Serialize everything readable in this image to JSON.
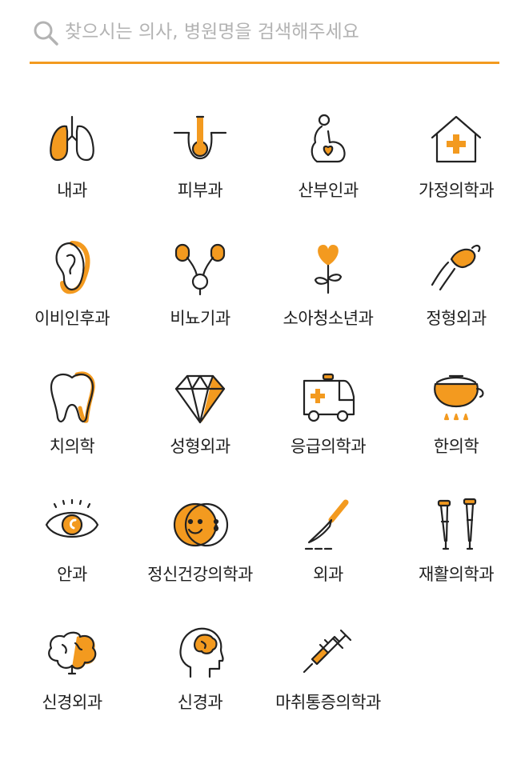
{
  "search": {
    "placeholder": "찾으시는 의사, 병원명을 검색해주세요",
    "value": ""
  },
  "categories": [
    {
      "label": "내과",
      "icon": "lungs-icon"
    },
    {
      "label": "피부과",
      "icon": "skin-follicle-icon"
    },
    {
      "label": "산부인과",
      "icon": "pregnant-woman-icon"
    },
    {
      "label": "가정의학과",
      "icon": "house-medical-icon"
    },
    {
      "label": "이비인후과",
      "icon": "ear-icon"
    },
    {
      "label": "비뇨기과",
      "icon": "kidneys-bladder-icon"
    },
    {
      "label": "소아청소년과",
      "icon": "heart-flower-icon"
    },
    {
      "label": "정형외과",
      "icon": "joint-bone-icon"
    },
    {
      "label": "치의학",
      "icon": "tooth-icon"
    },
    {
      "label": "성형외과",
      "icon": "diamond-icon"
    },
    {
      "label": "응급의학과",
      "icon": "ambulance-icon"
    },
    {
      "label": "한의학",
      "icon": "herbal-pot-icon"
    },
    {
      "label": "안과",
      "icon": "eye-icon"
    },
    {
      "label": "정신건강의학과",
      "icon": "smiling-face-icon"
    },
    {
      "label": "외과",
      "icon": "scalpel-icon"
    },
    {
      "label": "재활의학과",
      "icon": "crutches-icon"
    },
    {
      "label": "신경외과",
      "icon": "brain-icon"
    },
    {
      "label": "신경과",
      "icon": "head-brain-icon"
    },
    {
      "label": "마취통증의학과",
      "icon": "syringe-icon"
    }
  ],
  "colors": {
    "accent": "#F39A1F",
    "line": "#222222",
    "placeholder": "#b3b3b3"
  }
}
